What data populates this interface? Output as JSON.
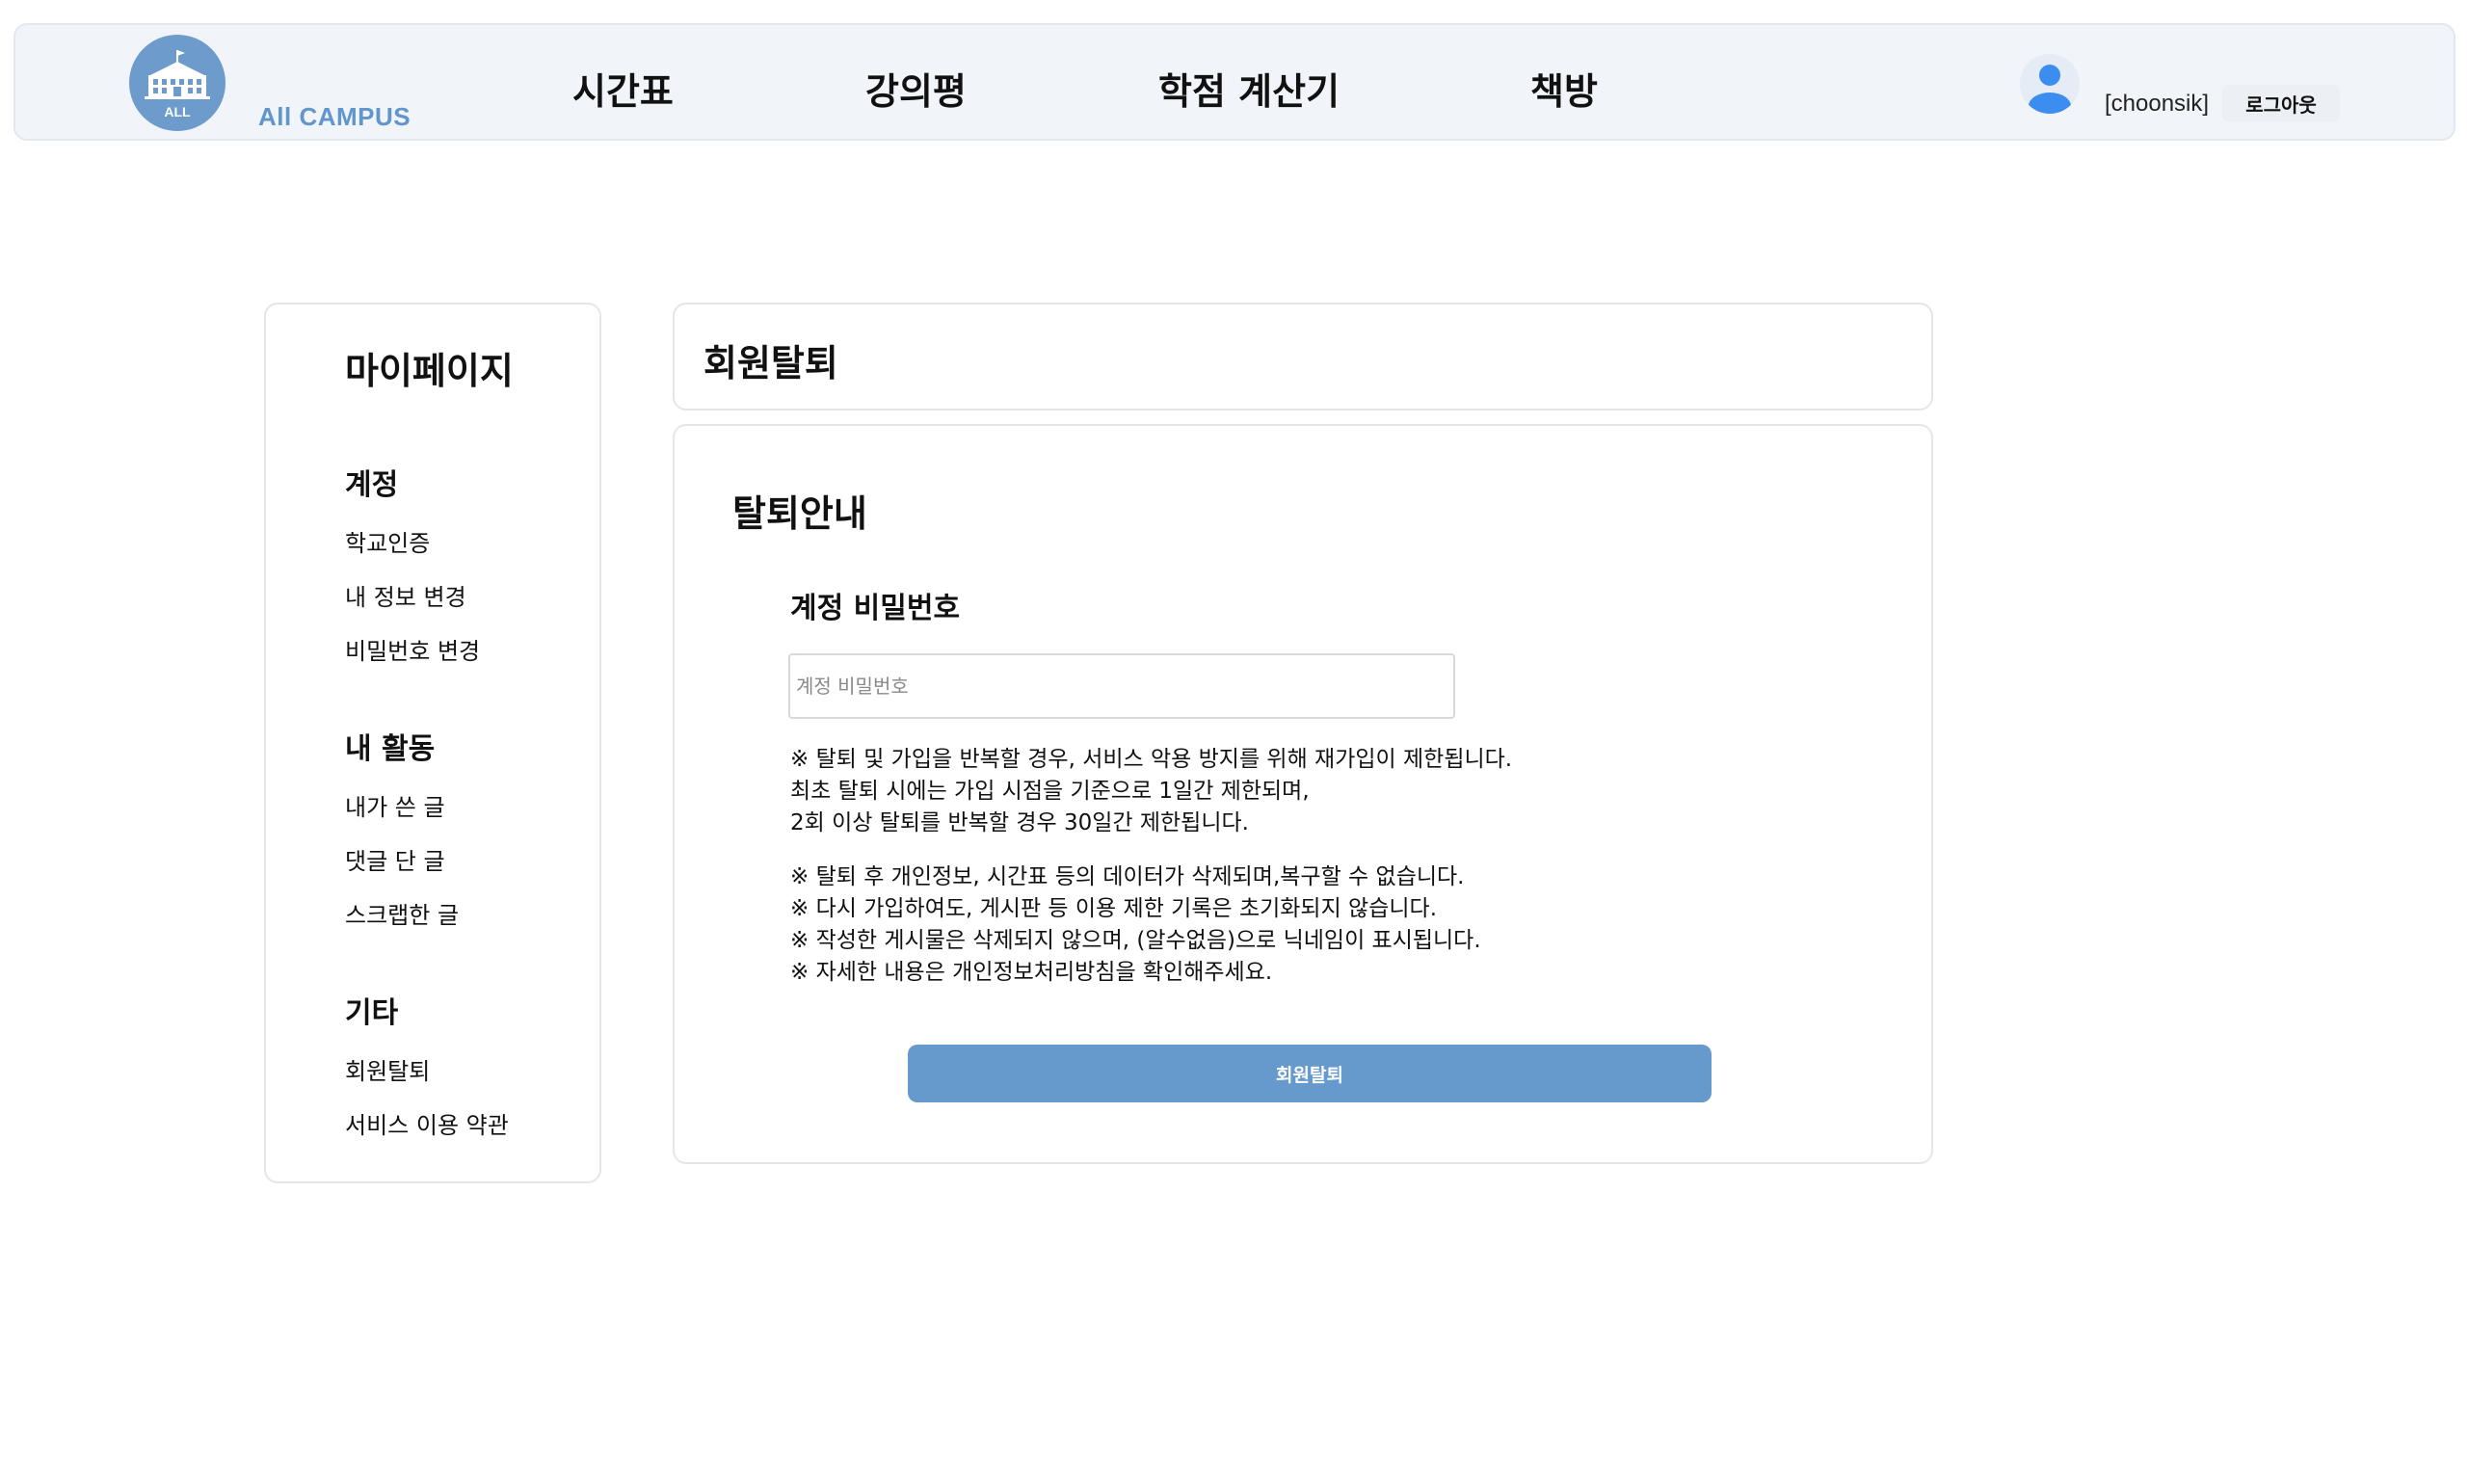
{
  "header": {
    "logo_text": "All CAMPUS",
    "logo_badge": "ALL",
    "nav": [
      "시간표",
      "강의평",
      "학점 계산기",
      "책방"
    ],
    "username": "[choonsik]",
    "logout_label": "로그아웃"
  },
  "sidebar": {
    "title": "마이페이지",
    "sections": [
      {
        "title": "계정",
        "items": [
          "학교인증",
          "내 정보 변경",
          "비밀번호 변경"
        ]
      },
      {
        "title": "내 활동",
        "items": [
          "내가 쓴 글",
          "댓글 단 글",
          "스크랩한 글"
        ]
      },
      {
        "title": "기타",
        "items": [
          "회원탈퇴",
          "서비스 이용 약관"
        ]
      }
    ]
  },
  "page_title": "회원탈퇴",
  "main": {
    "guide_title": "탈퇴안내",
    "password_label": "계정 비밀번호",
    "password_placeholder": "계정 비밀번호",
    "notice1": [
      "※ 탈퇴 및 가입을 반복할 경우, 서비스 악용 방지를 위해 재가입이 제한됩니다.",
      "최초 탈퇴 시에는 가입 시점을 기준으로 1일간 제한되며,",
      "2회 이상 탈퇴를 반복할 경우 30일간 제한됩니다."
    ],
    "notice2": [
      "※ 탈퇴 후 개인정보, 시간표 등의 데이터가 삭제되며,복구할 수 없습니다.",
      "※ 다시 가입하여도, 게시판 등 이용 제한 기록은 초기화되지 않습니다.",
      "※ 작성한 게시물은 삭제되지 않으며, (알수없음)으로 닉네임이 표시됩니다.",
      "※ 자세한 내용은 개인정보처리방침을 확인해주세요."
    ],
    "withdraw_button": "회원탈퇴"
  },
  "colors": {
    "accent": "#6699cc",
    "header_bg": "#f1f5fa",
    "logo_circle": "#6d9ccc",
    "avatar_icon": "#3b8ef0"
  },
  "icons": {
    "logo": "school-building-icon",
    "avatar": "user-avatar-icon"
  }
}
